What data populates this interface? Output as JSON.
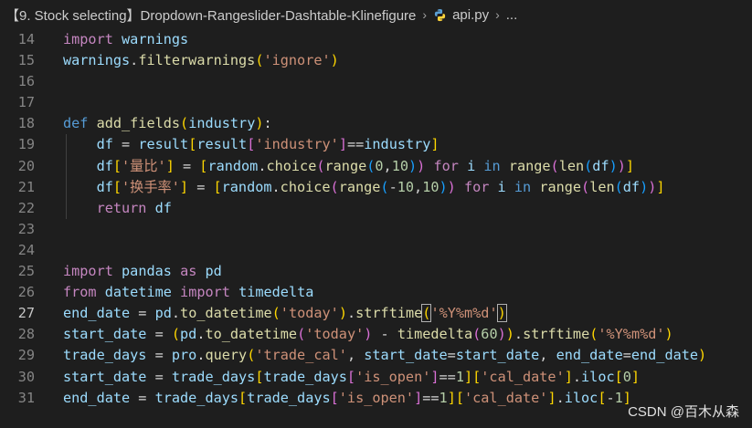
{
  "breadcrumb": {
    "folder": "【9. Stock selecting】Dropdown-Rangeslider-Dashtable-Klinefigure",
    "file": "api.py",
    "more": "..."
  },
  "icons": {
    "separator": "chevron-right-icon",
    "file_type": "python-icon"
  },
  "editor": {
    "active_line": 27,
    "lines": [
      {
        "n": "14",
        "tokens": [
          [
            "kw2",
            "import"
          ],
          [
            "op",
            " "
          ],
          [
            "var",
            "warnings"
          ]
        ]
      },
      {
        "n": "15",
        "tokens": [
          [
            "var",
            "warnings"
          ],
          [
            "op",
            "."
          ],
          [
            "fn",
            "filterwarnings"
          ],
          [
            "p1",
            "("
          ],
          [
            "str",
            "'ignore'"
          ],
          [
            "p1",
            ")"
          ]
        ]
      },
      {
        "n": "16",
        "tokens": []
      },
      {
        "n": "17",
        "tokens": []
      },
      {
        "n": "18",
        "tokens": [
          [
            "kw",
            "def"
          ],
          [
            "op",
            " "
          ],
          [
            "fn",
            "add_fields"
          ],
          [
            "p1",
            "("
          ],
          [
            "var",
            "industry"
          ],
          [
            "p1",
            ")"
          ],
          [
            "op",
            ":"
          ]
        ]
      },
      {
        "n": "19",
        "indent": true,
        "tokens": [
          [
            "op",
            "    "
          ],
          [
            "var",
            "df"
          ],
          [
            "op",
            " = "
          ],
          [
            "var",
            "result"
          ],
          [
            "p1",
            "["
          ],
          [
            "var",
            "result"
          ],
          [
            "p2",
            "["
          ],
          [
            "str",
            "'industry'"
          ],
          [
            "p2",
            "]"
          ],
          [
            "op",
            "=="
          ],
          [
            "var",
            "industry"
          ],
          [
            "p1",
            "]"
          ]
        ]
      },
      {
        "n": "20",
        "indent": true,
        "tokens": [
          [
            "op",
            "    "
          ],
          [
            "var",
            "df"
          ],
          [
            "p1",
            "["
          ],
          [
            "str",
            "'量比'"
          ],
          [
            "p1",
            "]"
          ],
          [
            "op",
            " = "
          ],
          [
            "p1",
            "["
          ],
          [
            "var",
            "random"
          ],
          [
            "op",
            "."
          ],
          [
            "fn",
            "choice"
          ],
          [
            "p2",
            "("
          ],
          [
            "fn",
            "range"
          ],
          [
            "p3",
            "("
          ],
          [
            "num",
            "0"
          ],
          [
            "op",
            ","
          ],
          [
            "num",
            "10"
          ],
          [
            "p3",
            ")"
          ],
          [
            "p2",
            ")"
          ],
          [
            "op",
            " "
          ],
          [
            "kw2",
            "for"
          ],
          [
            "op",
            " "
          ],
          [
            "var",
            "i"
          ],
          [
            "op",
            " "
          ],
          [
            "kw",
            "in"
          ],
          [
            "op",
            " "
          ],
          [
            "fn",
            "range"
          ],
          [
            "p2",
            "("
          ],
          [
            "fn",
            "len"
          ],
          [
            "p3",
            "("
          ],
          [
            "var",
            "df"
          ],
          [
            "p3",
            ")"
          ],
          [
            "p2",
            ")"
          ],
          [
            "p1",
            "]"
          ]
        ]
      },
      {
        "n": "21",
        "indent": true,
        "tokens": [
          [
            "op",
            "    "
          ],
          [
            "var",
            "df"
          ],
          [
            "p1",
            "["
          ],
          [
            "str",
            "'换手率'"
          ],
          [
            "p1",
            "]"
          ],
          [
            "op",
            " = "
          ],
          [
            "p1",
            "["
          ],
          [
            "var",
            "random"
          ],
          [
            "op",
            "."
          ],
          [
            "fn",
            "choice"
          ],
          [
            "p2",
            "("
          ],
          [
            "fn",
            "range"
          ],
          [
            "p3",
            "("
          ],
          [
            "op",
            "-"
          ],
          [
            "num",
            "10"
          ],
          [
            "op",
            ","
          ],
          [
            "num",
            "10"
          ],
          [
            "p3",
            ")"
          ],
          [
            "p2",
            ")"
          ],
          [
            "op",
            " "
          ],
          [
            "kw2",
            "for"
          ],
          [
            "op",
            " "
          ],
          [
            "var",
            "i"
          ],
          [
            "op",
            " "
          ],
          [
            "kw",
            "in"
          ],
          [
            "op",
            " "
          ],
          [
            "fn",
            "range"
          ],
          [
            "p2",
            "("
          ],
          [
            "fn",
            "len"
          ],
          [
            "p3",
            "("
          ],
          [
            "var",
            "df"
          ],
          [
            "p3",
            ")"
          ],
          [
            "p2",
            ")"
          ],
          [
            "p1",
            "]"
          ]
        ]
      },
      {
        "n": "22",
        "indent": true,
        "tokens": [
          [
            "op",
            "    "
          ],
          [
            "kw2",
            "return"
          ],
          [
            "op",
            " "
          ],
          [
            "var",
            "df"
          ]
        ]
      },
      {
        "n": "23",
        "tokens": []
      },
      {
        "n": "24",
        "tokens": []
      },
      {
        "n": "25",
        "tokens": [
          [
            "kw2",
            "import"
          ],
          [
            "op",
            " "
          ],
          [
            "var",
            "pandas"
          ],
          [
            "op",
            " "
          ],
          [
            "kw2",
            "as"
          ],
          [
            "op",
            " "
          ],
          [
            "var",
            "pd"
          ]
        ]
      },
      {
        "n": "26",
        "tokens": [
          [
            "kw2",
            "from"
          ],
          [
            "op",
            " "
          ],
          [
            "var",
            "datetime"
          ],
          [
            "op",
            " "
          ],
          [
            "kw2",
            "import"
          ],
          [
            "op",
            " "
          ],
          [
            "var",
            "timedelta"
          ]
        ]
      },
      {
        "n": "27",
        "tokens": [
          [
            "var",
            "end_date"
          ],
          [
            "op",
            " = "
          ],
          [
            "var",
            "pd"
          ],
          [
            "op",
            "."
          ],
          [
            "fn",
            "to_datetime"
          ],
          [
            "p1",
            "("
          ],
          [
            "str",
            "'today'"
          ],
          [
            "p1",
            ")"
          ],
          [
            "op",
            "."
          ],
          [
            "fn",
            "strftime"
          ],
          [
            "p1bm",
            "("
          ],
          [
            "str",
            "'%Y%m%d'"
          ],
          [
            "p1bm",
            ")"
          ]
        ]
      },
      {
        "n": "28",
        "tokens": [
          [
            "var",
            "start_date"
          ],
          [
            "op",
            " = "
          ],
          [
            "p1",
            "("
          ],
          [
            "var",
            "pd"
          ],
          [
            "op",
            "."
          ],
          [
            "fn",
            "to_datetime"
          ],
          [
            "p2",
            "("
          ],
          [
            "str",
            "'today'"
          ],
          [
            "p2",
            ")"
          ],
          [
            "op",
            " - "
          ],
          [
            "fn",
            "timedelta"
          ],
          [
            "p2",
            "("
          ],
          [
            "num",
            "60"
          ],
          [
            "p2",
            ")"
          ],
          [
            "p1",
            ")"
          ],
          [
            "op",
            "."
          ],
          [
            "fn",
            "strftime"
          ],
          [
            "p1",
            "("
          ],
          [
            "str",
            "'%Y%m%d'"
          ],
          [
            "p1",
            ")"
          ]
        ]
      },
      {
        "n": "29",
        "tokens": [
          [
            "var",
            "trade_days"
          ],
          [
            "op",
            " = "
          ],
          [
            "var",
            "pro"
          ],
          [
            "op",
            "."
          ],
          [
            "fn",
            "query"
          ],
          [
            "p1",
            "("
          ],
          [
            "str",
            "'trade_cal'"
          ],
          [
            "op",
            ", "
          ],
          [
            "var",
            "start_date"
          ],
          [
            "op",
            "="
          ],
          [
            "var",
            "start_date"
          ],
          [
            "op",
            ", "
          ],
          [
            "var",
            "end_date"
          ],
          [
            "op",
            "="
          ],
          [
            "var",
            "end_date"
          ],
          [
            "p1",
            ")"
          ]
        ]
      },
      {
        "n": "30",
        "tokens": [
          [
            "var",
            "start_date"
          ],
          [
            "op",
            " = "
          ],
          [
            "var",
            "trade_days"
          ],
          [
            "p1",
            "["
          ],
          [
            "var",
            "trade_days"
          ],
          [
            "p2",
            "["
          ],
          [
            "str",
            "'is_open'"
          ],
          [
            "p2",
            "]"
          ],
          [
            "op",
            "=="
          ],
          [
            "num",
            "1"
          ],
          [
            "p1",
            "]"
          ],
          [
            "p1",
            "["
          ],
          [
            "str",
            "'cal_date'"
          ],
          [
            "p1",
            "]"
          ],
          [
            "op",
            "."
          ],
          [
            "var",
            "iloc"
          ],
          [
            "p1",
            "["
          ],
          [
            "num",
            "0"
          ],
          [
            "p1",
            "]"
          ]
        ]
      },
      {
        "n": "31",
        "tokens": [
          [
            "var",
            "end_date"
          ],
          [
            "op",
            " = "
          ],
          [
            "var",
            "trade_days"
          ],
          [
            "p1",
            "["
          ],
          [
            "var",
            "trade_days"
          ],
          [
            "p2",
            "["
          ],
          [
            "str",
            "'is_open'"
          ],
          [
            "p2",
            "]"
          ],
          [
            "op",
            "=="
          ],
          [
            "num",
            "1"
          ],
          [
            "p1",
            "]"
          ],
          [
            "p1",
            "["
          ],
          [
            "str",
            "'cal_date'"
          ],
          [
            "p1",
            "]"
          ],
          [
            "op",
            "."
          ],
          [
            "var",
            "iloc"
          ],
          [
            "p1",
            "["
          ],
          [
            "op",
            "-"
          ],
          [
            "num",
            "1"
          ],
          [
            "p1",
            "]"
          ]
        ]
      }
    ]
  },
  "watermark": "CSDN @百木从森",
  "colors": {
    "background": "#1e1e1e",
    "keyword": "#569cd6",
    "control_keyword": "#c586c0",
    "function": "#dcdcaa",
    "variable": "#9cdcfe",
    "string": "#ce9178",
    "number": "#b5cea8",
    "bracket_1": "#ffd700",
    "bracket_2": "#da70d6",
    "bracket_3": "#179fff"
  }
}
